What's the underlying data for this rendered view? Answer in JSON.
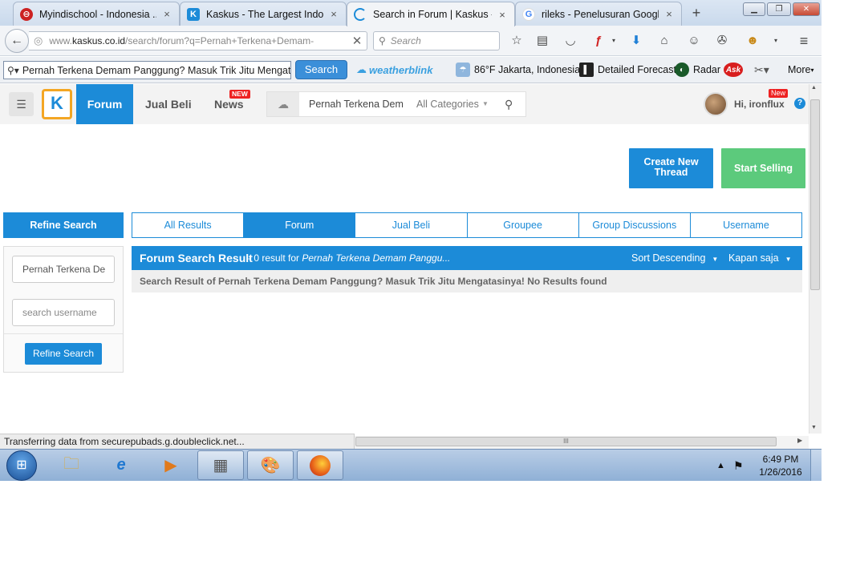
{
  "browser": {
    "tabs": [
      {
        "title": "Myindischool - Indonesia ...",
        "favicon_color": "#cc2222",
        "favicon_glyph": "⊖"
      },
      {
        "title": "Kaskus - The Largest Indon...",
        "favicon_color": "#1c8bd8",
        "favicon_glyph": "K"
      },
      {
        "title": "Search in Forum | Kaskus - ...",
        "favicon_color": "#1c8bd8",
        "favicon_glyph": "◌"
      },
      {
        "title": "rileks - Penelusuran Google",
        "favicon_color": "#4285f4",
        "favicon_glyph": "G"
      }
    ],
    "new_tab_glyph": "+",
    "close_glyph": "×",
    "url_prefix": "www.",
    "url_domain": "kaskus.co.id",
    "url_rest": "/search/forum?q=Pernah+Terkena+Demam-",
    "search_placeholder": "Search"
  },
  "toolbar": {
    "search_value": "Pernah Terkena Demam Panggung? Masuk Trik Jitu Mengata",
    "search_button": "Search",
    "weatherblink": "weatherblink",
    "weather_text": "86°F Jakarta, Indonesia",
    "forecast": "Detailed Forecast",
    "radar": "Radar",
    "ask": "Ask",
    "more": "More"
  },
  "kaskus": {
    "logo": "K",
    "nav_forum": "Forum",
    "nav_jualbeli": "Jual Beli",
    "nav_news": "News",
    "new_badge": "NEW",
    "search_query": "Pernah Terkena Dem",
    "category": "All Categories",
    "user_new_badge": "New",
    "greeting": "Hi, ironflux",
    "help": "?"
  },
  "actions": {
    "create_thread": "Create New Thread",
    "start_selling": "Start Selling"
  },
  "refine": {
    "title": "Refine Search",
    "query_value": "Pernah Terkena De",
    "username_placeholder": "search username",
    "button": "Refine Search"
  },
  "result_tabs": [
    "All Results",
    "Forum",
    "Jual Beli",
    "Groupee",
    "Group Discussions",
    "Username"
  ],
  "results": {
    "title": "Forum Search Result",
    "count_text": "- 0 result for",
    "query_text": "Pernah Terkena Demam Panggu...",
    "sort": "Sort Descending",
    "time": "Kapan saja",
    "message": "Search Result of Pernah Terkena Demam Panggung? Masuk Trik Jitu Mengatasinya! No Results found"
  },
  "status_text": "Transferring data from securepubads.g.doubleclick.net...",
  "scroll_grip": "III",
  "taskbar": {
    "time": "6:49 PM",
    "date": "1/26/2016"
  },
  "colors": {
    "kaskus_blue": "#1c8bd8",
    "sell_green": "#5cca7c",
    "logo_orange": "#f4a623",
    "badge_red": "#ee2222"
  }
}
